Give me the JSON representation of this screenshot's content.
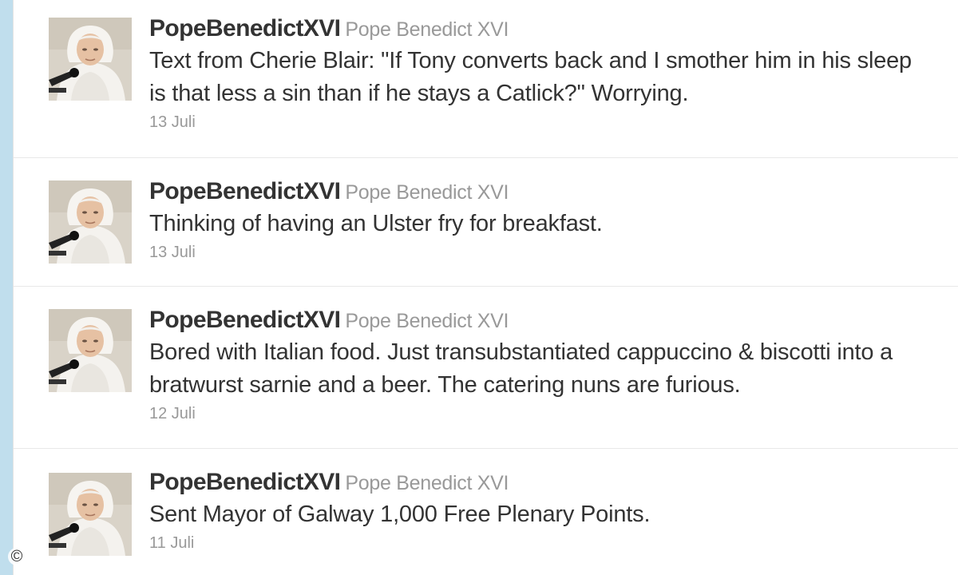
{
  "tweets": [
    {
      "screen_name": "PopeBenedictXVI",
      "full_name": "Pope Benedict XVI",
      "text": "Text from Cherie Blair: \"If Tony converts back and I smother him in his sleep is that less a sin than if he stays a Catlick?\" Worrying.",
      "timestamp": "13 Juli"
    },
    {
      "screen_name": "PopeBenedictXVI",
      "full_name": "Pope Benedict XVI",
      "text": "Thinking of having an Ulster fry for breakfast.",
      "timestamp": "13 Juli"
    },
    {
      "screen_name": "PopeBenedictXVI",
      "full_name": "Pope Benedict XVI",
      "text": "Bored with Italian food. Just transubstantiated cappuccino & biscotti into a bratwurst sarnie and a beer. The catering nuns are furious.",
      "timestamp": "12 Juli"
    },
    {
      "screen_name": "PopeBenedictXVI",
      "full_name": "Pope Benedict XVI",
      "text": "Sent Mayor of Galway 1,000 Free Plenary Points.",
      "timestamp": "11 Juli"
    }
  ],
  "watermark": "©"
}
